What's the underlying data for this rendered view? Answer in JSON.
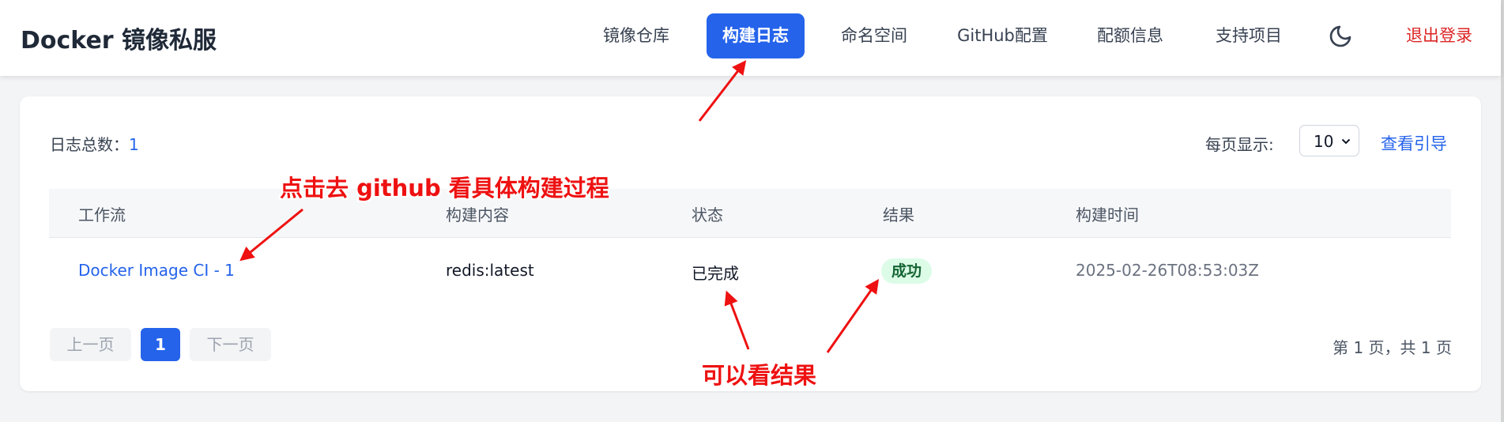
{
  "header": {
    "brand": "Docker 镜像私服",
    "nav": [
      {
        "label": "镜像仓库"
      },
      {
        "label": "构建日志"
      },
      {
        "label": "命名空间"
      },
      {
        "label": "GitHub配置"
      },
      {
        "label": "配额信息"
      },
      {
        "label": "支持项目"
      }
    ],
    "active_tab": "构建日志",
    "theme_icon": "moon-icon",
    "logout": "退出登录"
  },
  "toolbar": {
    "total_label": "日志总数：",
    "total_count": "1",
    "per_page_label": "每页显示:",
    "per_page_value": "10",
    "guide_link": "查看引导"
  },
  "table": {
    "columns": [
      "工作流",
      "构建内容",
      "状态",
      "结果",
      "构建时间"
    ],
    "rows": [
      {
        "workflow": "Docker Image CI - 1",
        "content": "redis:latest",
        "status": "已完成",
        "result": "成功",
        "time": "2025-02-26T08:53:03Z"
      }
    ]
  },
  "pagination": {
    "prev": "上一页",
    "current": "1",
    "next": "下一页",
    "info": "第 1 页，共 1 页"
  },
  "annotations": {
    "workflow_note": "点击去 github 看具体构建过程",
    "result_note": "可以看结果"
  },
  "colors": {
    "accent": "#2563eb",
    "logout": "#dc2626",
    "success_bg": "#dcfce7",
    "success_text": "#166534",
    "annotation": "#ee1111"
  }
}
